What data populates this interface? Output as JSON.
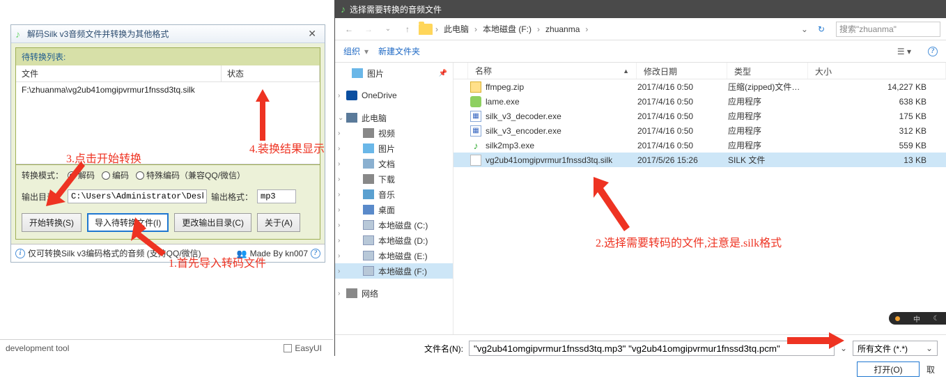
{
  "app": {
    "title": "解码Silk v3音频文件并转换为其他格式",
    "panel_title": "待转换列表:",
    "columns": {
      "file": "文件",
      "status": "状态"
    },
    "rows": [
      {
        "file": "F:\\zhuanma\\vg2ub41omgipvrmur1fnssd3tq.silk",
        "status": ""
      }
    ],
    "mode_label": "转换模式：",
    "modes": {
      "decode": "解码",
      "encode": "编码",
      "special": "特殊编码（兼容QQ/微信）"
    },
    "outdir_label": "输出目录：",
    "outdir_value": "C:\\Users\\Administrator\\Desktop\\s",
    "outfmt_label": "输出格式：",
    "outfmt_value": "mp3",
    "buttons": {
      "start": "开始转换(S)",
      "import": "导入待转换文件(I)",
      "outdir": "更改输出目录(C)",
      "about": "关于(A)"
    },
    "status_text": "仅可转换Silk v3编码格式的音频 (支持QQ/微信)",
    "made_by": "Made By kn007"
  },
  "annotations": {
    "a1": "1.首先导入转码文件",
    "a3": "3.点击开始转换",
    "a4": "4.装换结果显示",
    "a2": "2.选择需要转码的文件,注意是.silk格式"
  },
  "bottom": {
    "dev": "development tool",
    "easyui": "EasyUI"
  },
  "dialog": {
    "title": "选择需要转换的音频文件",
    "crumbs": [
      "此电脑",
      "本地磁盘 (F:)",
      "zhuanma"
    ],
    "search_placeholder": "搜索\"zhuanma\"",
    "toolbar": {
      "organize": "组织",
      "newfolder": "新建文件夹"
    },
    "tree": {
      "pictures": "图片",
      "onedrive": "OneDrive",
      "thispc": "此电脑",
      "video": "视频",
      "pictures2": "图片",
      "documents": "文档",
      "downloads": "下载",
      "music": "音乐",
      "desktop": "桌面",
      "driveC": "本地磁盘 (C:)",
      "driveD": "本地磁盘 (D:)",
      "driveE": "本地磁盘 (E:)",
      "driveF": "本地磁盘 (F:)",
      "network": "网络"
    },
    "columns": {
      "name": "名称",
      "date": "修改日期",
      "type": "类型",
      "size": "大小"
    },
    "files": [
      {
        "name": "ffmpeg.zip",
        "date": "2017/4/16 0:50",
        "type": "压缩(zipped)文件…",
        "size": "14,227 KB",
        "ico": "zip"
      },
      {
        "name": "lame.exe",
        "date": "2017/4/16 0:50",
        "type": "应用程序",
        "size": "638 KB",
        "ico": "lame"
      },
      {
        "name": "silk_v3_decoder.exe",
        "date": "2017/4/16 0:50",
        "type": "应用程序",
        "size": "175 KB",
        "ico": "exe"
      },
      {
        "name": "silk_v3_encoder.exe",
        "date": "2017/4/16 0:50",
        "type": "应用程序",
        "size": "312 KB",
        "ico": "exe"
      },
      {
        "name": "silk2mp3.exe",
        "date": "2017/4/16 0:50",
        "type": "应用程序",
        "size": "559 KB",
        "ico": "mus"
      },
      {
        "name": "vg2ub41omgipvrmur1fnssd3tq.silk",
        "date": "2017/5/26 15:26",
        "type": "SILK 文件",
        "size": "13 KB",
        "ico": "blank",
        "sel": true
      }
    ],
    "filename_label": "文件名(N):",
    "filename_value": "\"vg2ub41omgipvrmur1fnssd3tq.mp3\" \"vg2ub41omgipvrmur1fnssd3tq.pcm\"",
    "filter": "所有文件 (*.*)",
    "open": "打开(O)",
    "cancel": "取"
  },
  "ime": {
    "lang": "中"
  }
}
